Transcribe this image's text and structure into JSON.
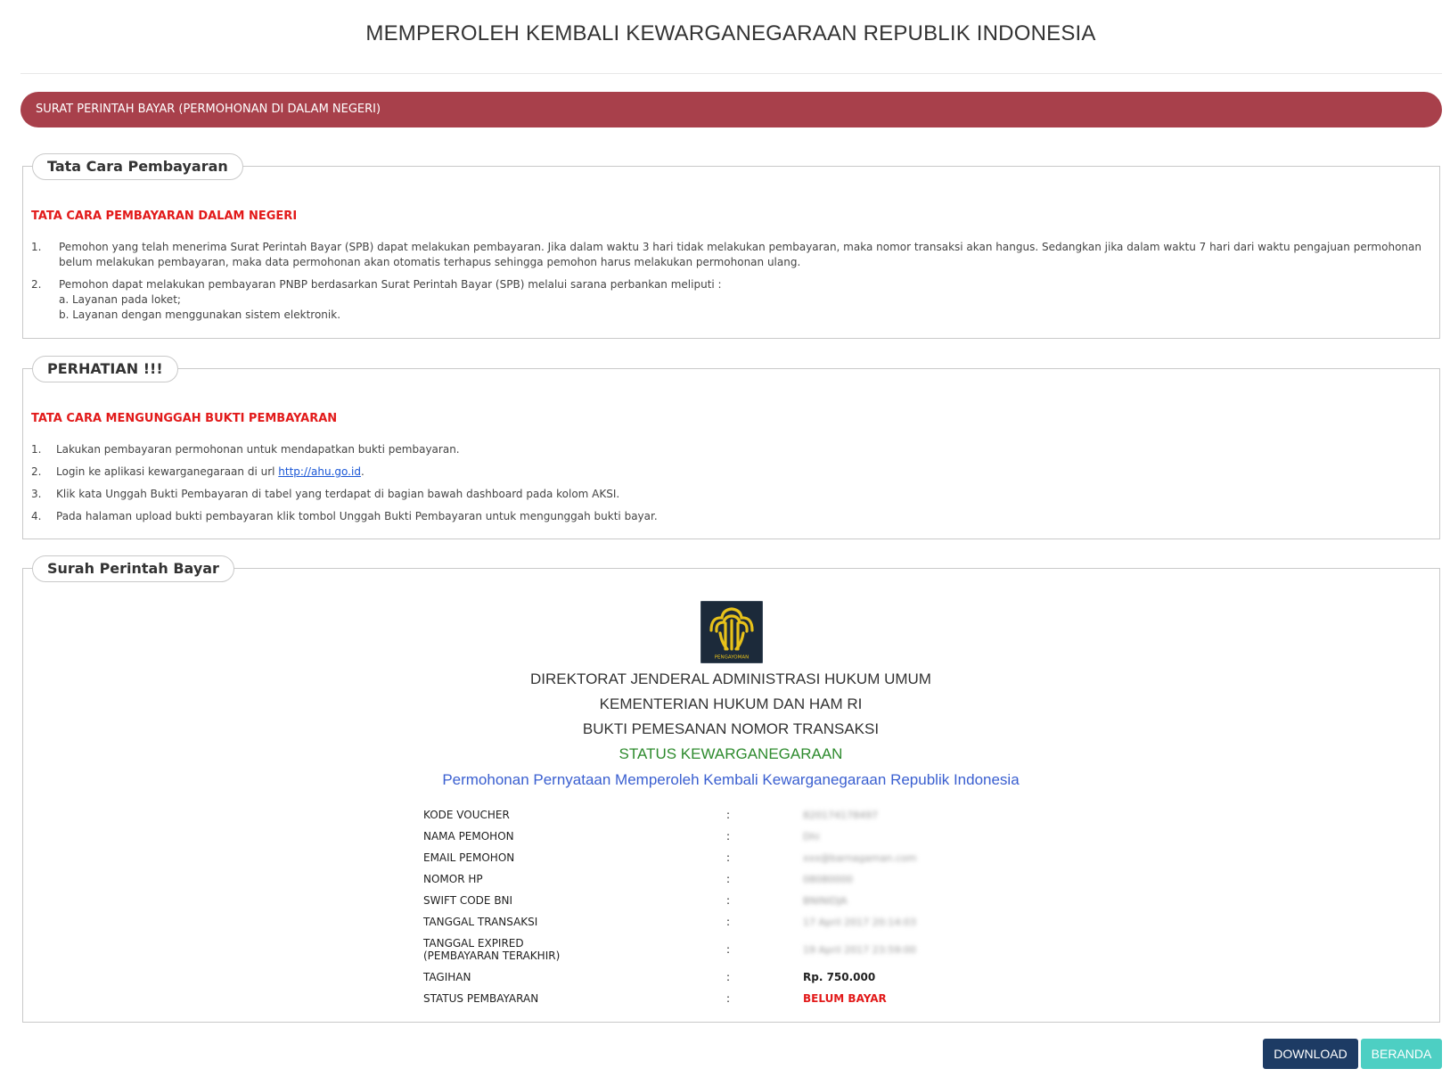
{
  "page": {
    "title": "MEMPEROLEH KEMBALI KEWARGANEGARAAN REPUBLIK INDONESIA"
  },
  "section_bar": {
    "label": "SURAT PERINTAH BAYAR (PERMOHONAN DI DALAM NEGERI)"
  },
  "tata_cara": {
    "legend": "Tata Cara Pembayaran",
    "heading": "TATA CARA PEMBAYARAN DALAM NEGERI",
    "items": [
      {
        "num": "1.",
        "text": "Pemohon yang telah menerima Surat Perintah Bayar (SPB) dapat melakukan pembayaran. Jika dalam waktu 3 hari tidak melakukan pembayaran, maka nomor transaksi akan hangus. Sedangkan jika dalam waktu 7 hari dari waktu pengajuan permohonan belum melakukan pembayaran, maka data permohonan akan otomatis terhapus sehingga pemohon harus melakukan permohonan ulang."
      },
      {
        "num": "2.",
        "text": "Pemohon dapat melakukan pembayaran PNBP berdasarkan Surat Perintah Bayar (SPB) melalui sarana perbankan meliputi :",
        "sub": [
          "a. Layanan pada loket;",
          "b. Layanan dengan menggunakan sistem elektronik."
        ]
      }
    ]
  },
  "perhatian": {
    "legend": "PERHATIAN !!!",
    "heading": "TATA CARA MENGUNGGAH BUKTI PEMBAYARAN",
    "items": [
      {
        "num": "1.",
        "text": "Lakukan pembayaran permohonan untuk mendapatkan bukti pembayaran."
      },
      {
        "num": "2.",
        "text_before": "Login ke aplikasi kewarganegaraan di url ",
        "link": "http://ahu.go.id",
        "text_after": "."
      },
      {
        "num": "3.",
        "text": "Klik kata Unggah Bukti Pembayaran di tabel yang terdapat di bagian bawah dashboard pada kolom AKSI."
      },
      {
        "num": "4.",
        "text": "Pada halaman upload bukti pembayaran klik tombol Unggah Bukti Pembayaran untuk mengunggah bukti bayar."
      }
    ]
  },
  "spb": {
    "legend": "Surah Perintah Bayar",
    "logo_caption": "PENGAYOMAN",
    "line1": "DIREKTORAT JENDERAL ADMINISTRASI HUKUM UMUM",
    "line2": "KEMENTERIAN HUKUM DAN HAM RI",
    "line3": "BUKTI PEMESANAN NOMOR TRANSAKSI",
    "status_title": "STATUS KEWARGANEGARAAN",
    "subtitle": "Permohonan Pernyataan Memperoleh Kembali Kewarganegaraan Republik Indonesia",
    "separator": ":",
    "rows": [
      {
        "label": "KODE VOUCHER",
        "value": "820174178497"
      },
      {
        "label": "NAMA PEMOHON",
        "value": "Dhi"
      },
      {
        "label": "EMAIL PEMOHON",
        "value": "xxx@barnagaman.com"
      },
      {
        "label": "NOMOR HP",
        "value": "08080000"
      },
      {
        "label": "SWIFT CODE BNI",
        "value": "BNINIDJA"
      },
      {
        "label": "TANGGAL TRANSAKSI",
        "value": "17 April 2017 20:14:03"
      },
      {
        "label": "TANGGAL EXPIRED",
        "label2": "(PEMBAYARAN TERAKHIR)",
        "value": "19 April 2017 23:59:00"
      },
      {
        "label": "TAGIHAN",
        "value": "Rp. 750.000"
      },
      {
        "label": "STATUS PEMBAYARAN",
        "value": "BELUM BAYAR"
      }
    ]
  },
  "buttons": {
    "download": "DOWNLOAD",
    "beranda": "BERANDA"
  },
  "colors": {
    "section_bar": "#a8404b",
    "red_heading": "#e21a1a",
    "status_green": "#2e8b2e",
    "subtitle_blue": "#3a5fd0",
    "download_bg": "#1d3b64",
    "beranda_bg": "#4dcfc3",
    "logo_bg": "#1c2a3a",
    "logo_gold": "#e8c21a"
  }
}
